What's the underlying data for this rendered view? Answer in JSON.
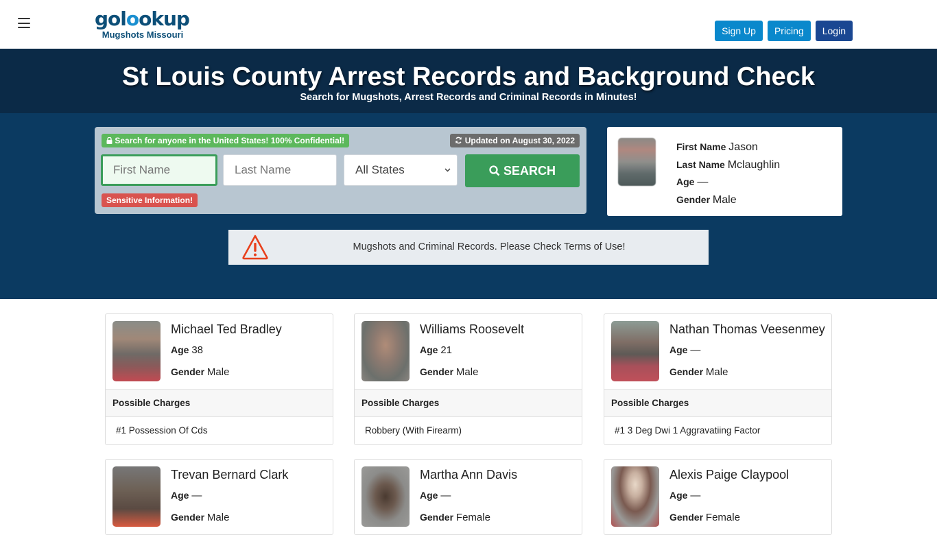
{
  "header": {
    "logo_text_a": "gol",
    "logo_text_o": "o",
    "logo_text_b": "okup",
    "logo_subtitle": "Mugshots Missouri",
    "nav": {
      "signup": "Sign Up",
      "pricing": "Pricing",
      "login": "Login"
    }
  },
  "hero": {
    "title": "St Louis County Arrest Records and Background Check",
    "subtitle": "Search for Mugshots, Arrest Records and Criminal Records in Minutes!"
  },
  "search": {
    "confidential_badge": "Search for anyone in the United States! 100% Confidential!",
    "updated_badge": "Updated on August 30, 2022",
    "first_name_placeholder": "First Name",
    "last_name_placeholder": "Last Name",
    "state_selected": "All States",
    "search_button": "SEARCH",
    "sensitive_badge": "Sensitive Information!"
  },
  "featured_profile": {
    "first_name_label": "First Name",
    "first_name": "Jason",
    "last_name_label": "Last Name",
    "last_name": "Mclaughlin",
    "age_label": "Age",
    "age": "—",
    "gender_label": "Gender",
    "gender": "Male"
  },
  "warning": {
    "text": "Mugshots and Criminal Records. Please Check Terms of Use!"
  },
  "labels": {
    "age": "Age",
    "gender": "Gender",
    "possible_charges": "Possible Charges"
  },
  "records": [
    {
      "name": "Michael Ted Bradley",
      "age": "38",
      "gender": "Male",
      "charge": "#1 Possession Of Cds"
    },
    {
      "name": "Williams Roosevelt",
      "age": "21",
      "gender": "Male",
      "charge": "Robbery (With Firearm)"
    },
    {
      "name": "Nathan Thomas Veesenmey",
      "age": "—",
      "gender": "Male",
      "charge": "#1 3 Deg Dwi 1 Aggravatiing Factor"
    },
    {
      "name": "Trevan Bernard Clark",
      "age": "—",
      "gender": "Male",
      "charge": ""
    },
    {
      "name": "Martha Ann Davis",
      "age": "—",
      "gender": "Female",
      "charge": ""
    },
    {
      "name": "Alexis Paige Claypool",
      "age": "—",
      "gender": "Female",
      "charge": ""
    }
  ],
  "colors": {
    "hero_bg": "#0b2a47",
    "search_band_bg": "#0b3a61",
    "search_green": "#3a9d5a",
    "signup_blue": "#0a88cc",
    "login_navy": "#1a4792",
    "warning_red": "#e8401c"
  }
}
